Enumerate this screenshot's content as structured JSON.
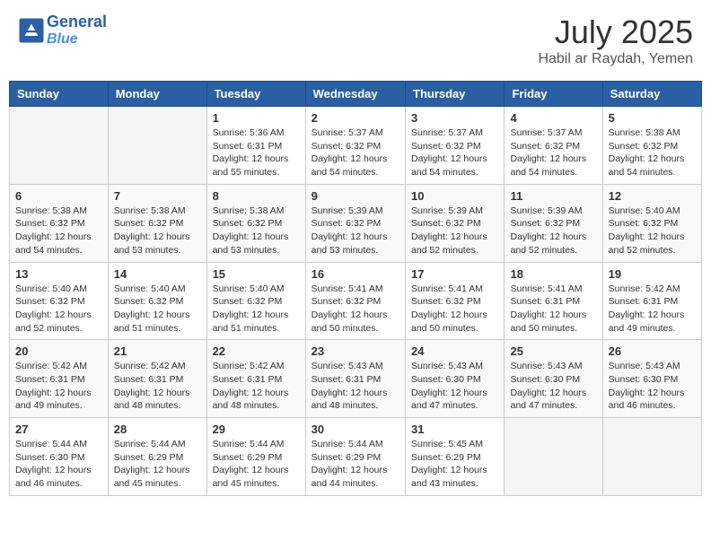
{
  "header": {
    "logo_line1": "General",
    "logo_line2": "Blue",
    "month_title": "July 2025",
    "location": "Habil ar Raydah, Yemen"
  },
  "days_of_week": [
    "Sunday",
    "Monday",
    "Tuesday",
    "Wednesday",
    "Thursday",
    "Friday",
    "Saturday"
  ],
  "weeks": [
    [
      {
        "day": "",
        "info": ""
      },
      {
        "day": "",
        "info": ""
      },
      {
        "day": "1",
        "sunrise": "5:36 AM",
        "sunset": "6:31 PM",
        "daylight": "12 hours and 55 minutes."
      },
      {
        "day": "2",
        "sunrise": "5:37 AM",
        "sunset": "6:32 PM",
        "daylight": "12 hours and 54 minutes."
      },
      {
        "day": "3",
        "sunrise": "5:37 AM",
        "sunset": "6:32 PM",
        "daylight": "12 hours and 54 minutes."
      },
      {
        "day": "4",
        "sunrise": "5:37 AM",
        "sunset": "6:32 PM",
        "daylight": "12 hours and 54 minutes."
      },
      {
        "day": "5",
        "sunrise": "5:38 AM",
        "sunset": "6:32 PM",
        "daylight": "12 hours and 54 minutes."
      }
    ],
    [
      {
        "day": "6",
        "sunrise": "5:38 AM",
        "sunset": "6:32 PM",
        "daylight": "12 hours and 54 minutes."
      },
      {
        "day": "7",
        "sunrise": "5:38 AM",
        "sunset": "6:32 PM",
        "daylight": "12 hours and 53 minutes."
      },
      {
        "day": "8",
        "sunrise": "5:38 AM",
        "sunset": "6:32 PM",
        "daylight": "12 hours and 53 minutes."
      },
      {
        "day": "9",
        "sunrise": "5:39 AM",
        "sunset": "6:32 PM",
        "daylight": "12 hours and 53 minutes."
      },
      {
        "day": "10",
        "sunrise": "5:39 AM",
        "sunset": "6:32 PM",
        "daylight": "12 hours and 52 minutes."
      },
      {
        "day": "11",
        "sunrise": "5:39 AM",
        "sunset": "6:32 PM",
        "daylight": "12 hours and 52 minutes."
      },
      {
        "day": "12",
        "sunrise": "5:40 AM",
        "sunset": "6:32 PM",
        "daylight": "12 hours and 52 minutes."
      }
    ],
    [
      {
        "day": "13",
        "sunrise": "5:40 AM",
        "sunset": "6:32 PM",
        "daylight": "12 hours and 52 minutes."
      },
      {
        "day": "14",
        "sunrise": "5:40 AM",
        "sunset": "6:32 PM",
        "daylight": "12 hours and 51 minutes."
      },
      {
        "day": "15",
        "sunrise": "5:40 AM",
        "sunset": "6:32 PM",
        "daylight": "12 hours and 51 minutes."
      },
      {
        "day": "16",
        "sunrise": "5:41 AM",
        "sunset": "6:32 PM",
        "daylight": "12 hours and 50 minutes."
      },
      {
        "day": "17",
        "sunrise": "5:41 AM",
        "sunset": "6:32 PM",
        "daylight": "12 hours and 50 minutes."
      },
      {
        "day": "18",
        "sunrise": "5:41 AM",
        "sunset": "6:31 PM",
        "daylight": "12 hours and 50 minutes."
      },
      {
        "day": "19",
        "sunrise": "5:42 AM",
        "sunset": "6:31 PM",
        "daylight": "12 hours and 49 minutes."
      }
    ],
    [
      {
        "day": "20",
        "sunrise": "5:42 AM",
        "sunset": "6:31 PM",
        "daylight": "12 hours and 49 minutes."
      },
      {
        "day": "21",
        "sunrise": "5:42 AM",
        "sunset": "6:31 PM",
        "daylight": "12 hours and 48 minutes."
      },
      {
        "day": "22",
        "sunrise": "5:42 AM",
        "sunset": "6:31 PM",
        "daylight": "12 hours and 48 minutes."
      },
      {
        "day": "23",
        "sunrise": "5:43 AM",
        "sunset": "6:31 PM",
        "daylight": "12 hours and 48 minutes."
      },
      {
        "day": "24",
        "sunrise": "5:43 AM",
        "sunset": "6:30 PM",
        "daylight": "12 hours and 47 minutes."
      },
      {
        "day": "25",
        "sunrise": "5:43 AM",
        "sunset": "6:30 PM",
        "daylight": "12 hours and 47 minutes."
      },
      {
        "day": "26",
        "sunrise": "5:43 AM",
        "sunset": "6:30 PM",
        "daylight": "12 hours and 46 minutes."
      }
    ],
    [
      {
        "day": "27",
        "sunrise": "5:44 AM",
        "sunset": "6:30 PM",
        "daylight": "12 hours and 46 minutes."
      },
      {
        "day": "28",
        "sunrise": "5:44 AM",
        "sunset": "6:29 PM",
        "daylight": "12 hours and 45 minutes."
      },
      {
        "day": "29",
        "sunrise": "5:44 AM",
        "sunset": "6:29 PM",
        "daylight": "12 hours and 45 minutes."
      },
      {
        "day": "30",
        "sunrise": "5:44 AM",
        "sunset": "6:29 PM",
        "daylight": "12 hours and 44 minutes."
      },
      {
        "day": "31",
        "sunrise": "5:45 AM",
        "sunset": "6:29 PM",
        "daylight": "12 hours and 43 minutes."
      },
      {
        "day": "",
        "info": ""
      },
      {
        "day": "",
        "info": ""
      }
    ]
  ],
  "labels": {
    "sunrise": "Sunrise:",
    "sunset": "Sunset:",
    "daylight": "Daylight:"
  }
}
